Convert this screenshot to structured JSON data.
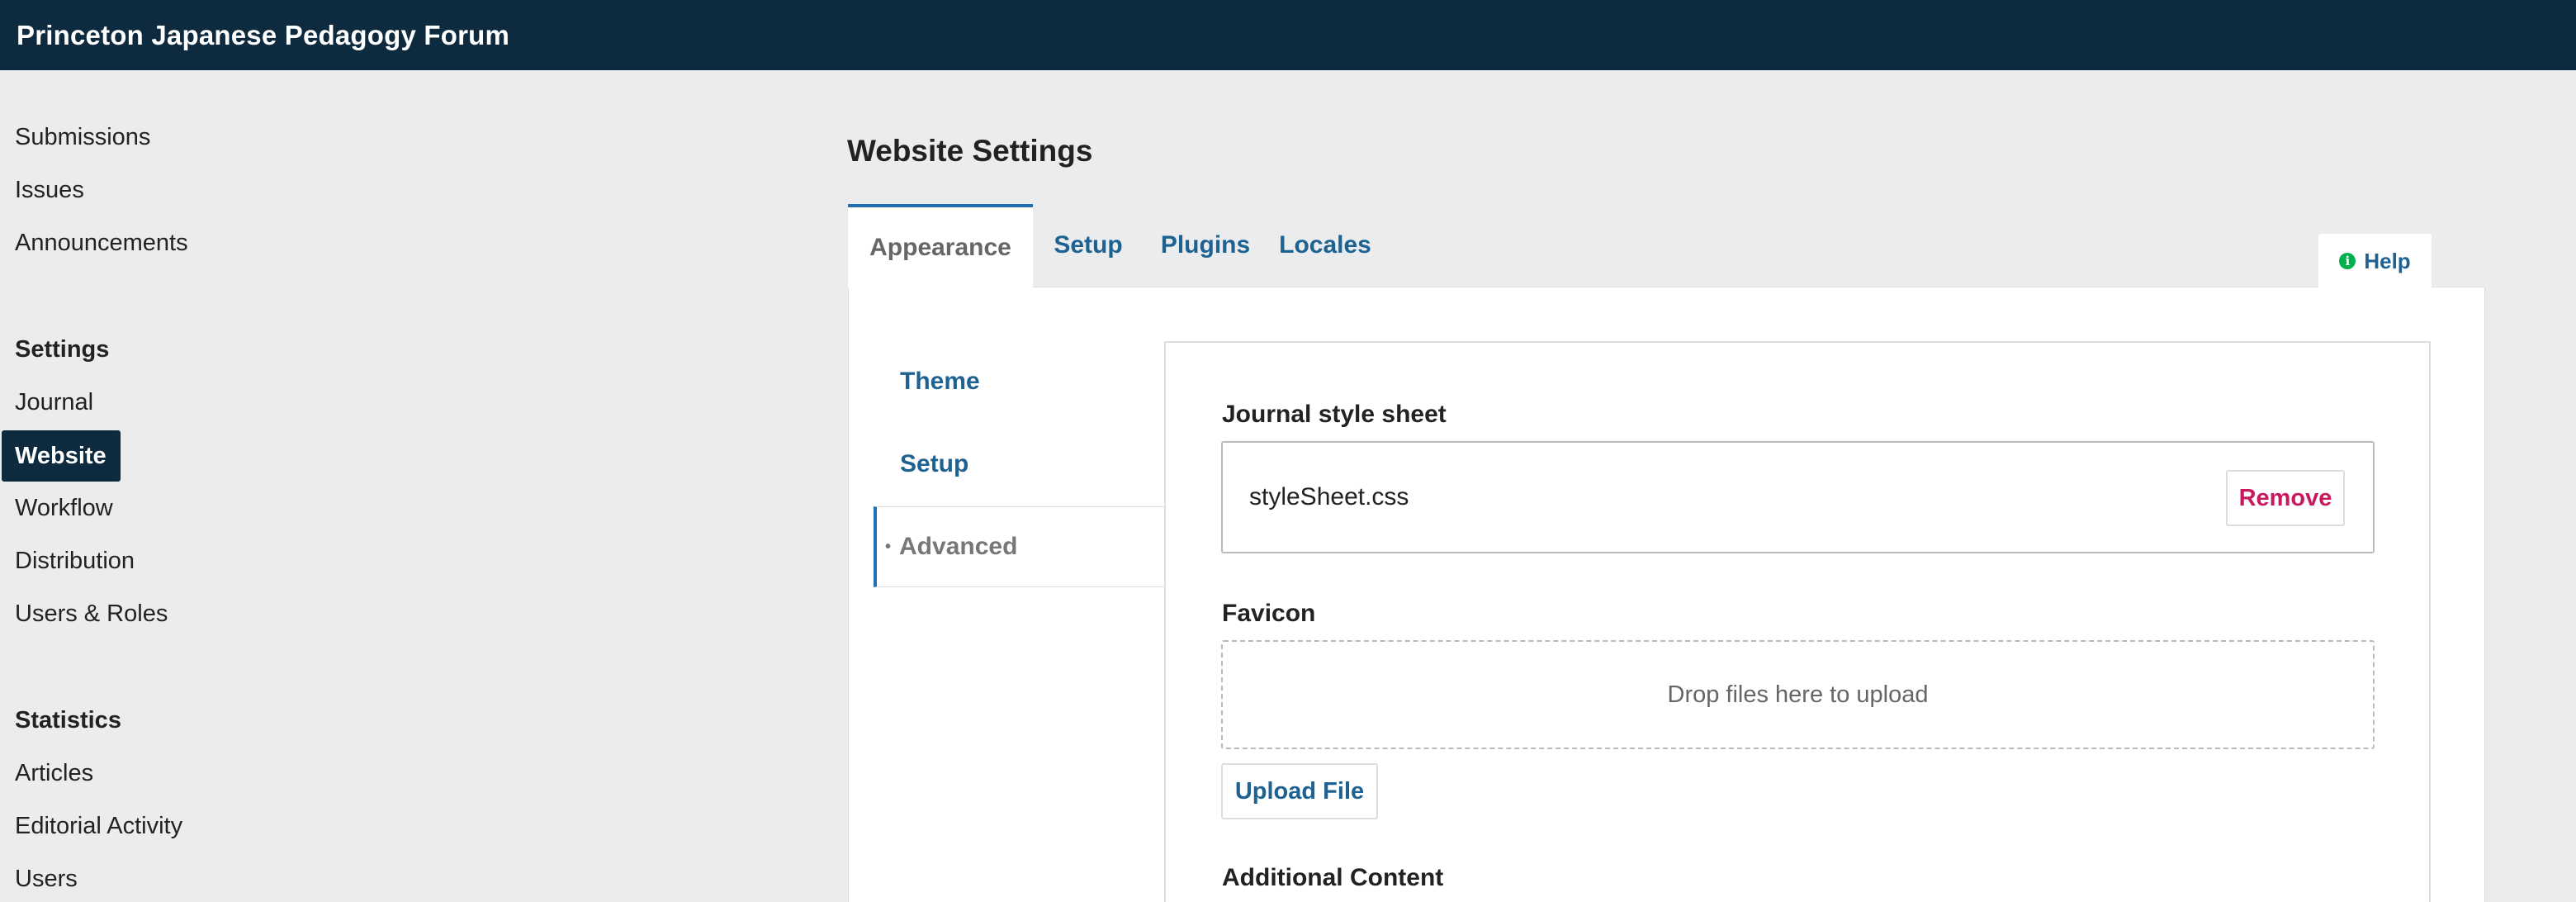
{
  "header": {
    "site_title": "Princeton Japanese Pedagogy Forum"
  },
  "sidebar": {
    "items": [
      {
        "label": "Submissions"
      },
      {
        "label": "Issues"
      },
      {
        "label": "Announcements"
      }
    ],
    "settings_heading": "Settings",
    "settings_items": [
      {
        "label": "Journal"
      },
      {
        "label": "Website"
      },
      {
        "label": "Workflow"
      },
      {
        "label": "Distribution"
      },
      {
        "label": "Users & Roles"
      }
    ],
    "statistics_heading": "Statistics",
    "statistics_items": [
      {
        "label": "Articles"
      },
      {
        "label": "Editorial Activity"
      },
      {
        "label": "Users"
      }
    ]
  },
  "main": {
    "page_title": "Website Settings",
    "tabs": [
      {
        "label": "Appearance"
      },
      {
        "label": "Setup"
      },
      {
        "label": "Plugins"
      },
      {
        "label": "Locales"
      }
    ],
    "help_label": "Help",
    "subnav": [
      {
        "label": "Theme"
      },
      {
        "label": "Setup"
      },
      {
        "label": "Advanced"
      }
    ],
    "stylesheet": {
      "label": "Journal style sheet",
      "file_name": "styleSheet.css",
      "remove_label": "Remove"
    },
    "favicon": {
      "label": "Favicon",
      "dropzone_text": "Drop files here to upload",
      "upload_label": "Upload File"
    },
    "additional_content_label": "Additional Content"
  },
  "colors": {
    "header_bg": "#0e2a3f",
    "link": "#1e6292",
    "active_border": "#1e6fb4",
    "remove": "#c9195e",
    "help_icon": "#00b24e"
  },
  "icons": {
    "help": "info-circle-icon"
  }
}
